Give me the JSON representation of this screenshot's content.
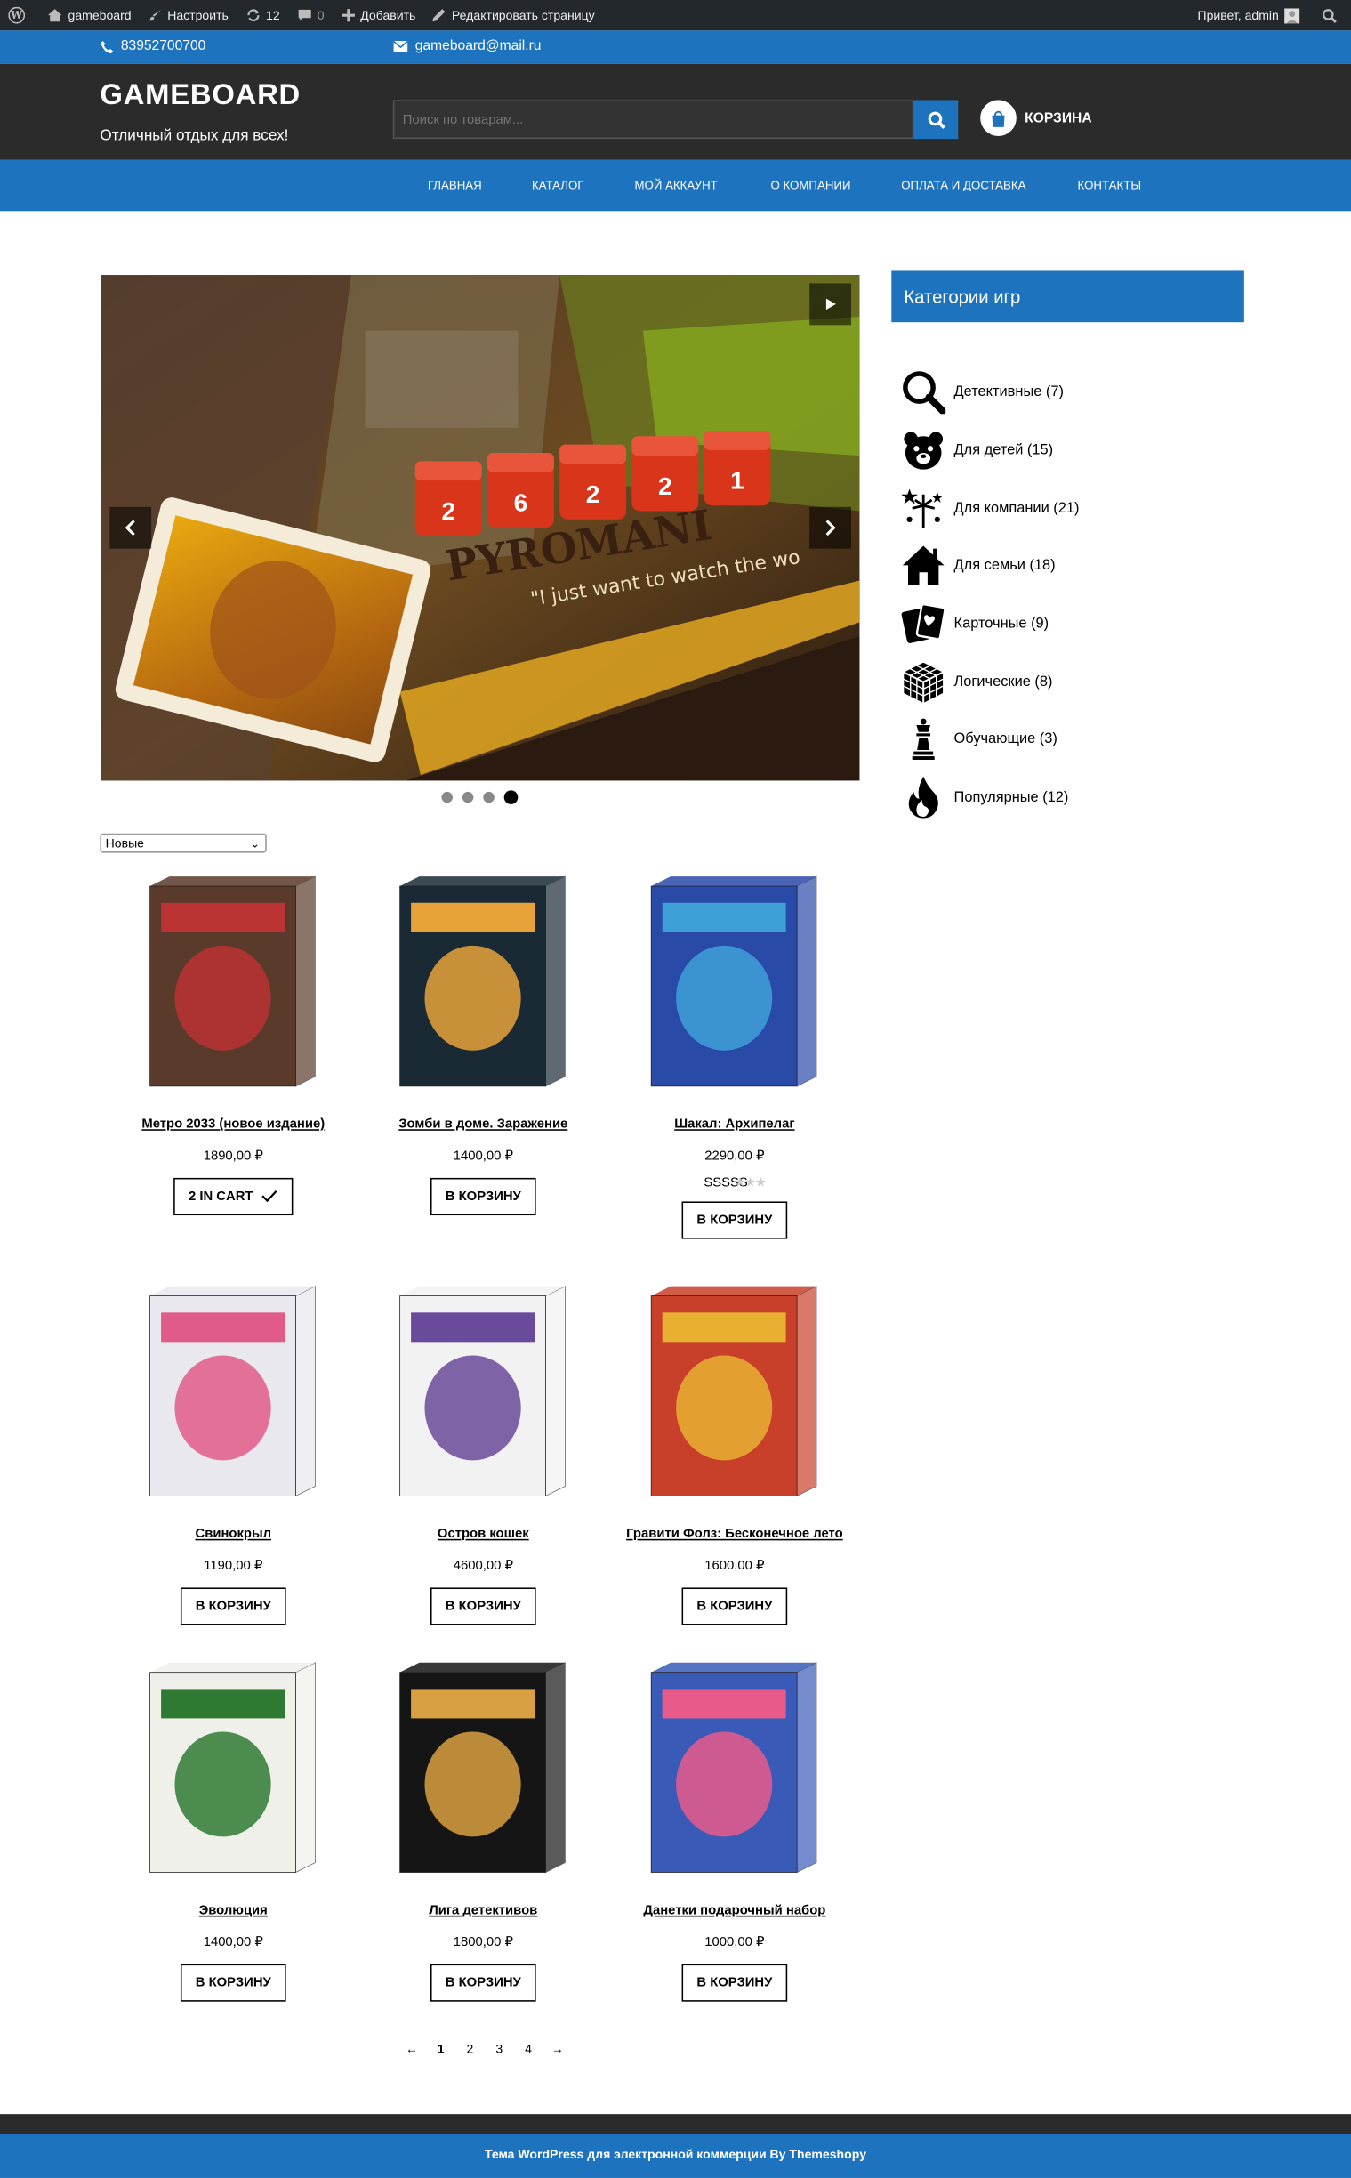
{
  "admin_bar": {
    "site": "gameboard",
    "customize": "Настроить",
    "updates": "12",
    "comments": "0",
    "add_new": "Добавить",
    "edit_page": "Редактировать страницу",
    "greeting": "Привет, admin"
  },
  "contacts": {
    "phone": "83952700700",
    "email": "gameboard@mail.ru"
  },
  "header": {
    "logo": "GAMEBOARD",
    "tagline": "Отличный отдых для всех!",
    "search_placeholder": "Поиск по товарам...",
    "cart_label": "КОРЗИНА"
  },
  "nav": {
    "items": [
      "ГЛАВНАЯ",
      "КАТАЛОГ",
      "МОЙ АККАУНТ",
      "О КОМПАНИИ",
      "ОПЛАТА И ДОСТАВКА",
      "КОНТАКТЫ"
    ]
  },
  "slider": {
    "brand_text": "PYROMANI",
    "quote_text": "\"I just want to watch the wo",
    "dice": [
      "2",
      "6",
      "2",
      "2",
      "1"
    ],
    "dots": 4,
    "active_dot": 4
  },
  "sort": {
    "selected": "Новые"
  },
  "products": [
    {
      "title": "Метро 2033 (новое издание)",
      "price": "1890,00 ₽",
      "button": "2 IN CART",
      "in_cart": true,
      "rating": null,
      "box_color": "#5a3a2a",
      "accent": "#b33"
    },
    {
      "title": "Зомби в доме. Заражение",
      "price": "1400,00 ₽",
      "button": "В КОРЗИНУ",
      "in_cart": false,
      "rating": null,
      "box_color": "#1a2a35",
      "accent": "#e8a23a"
    },
    {
      "title": "Шакал: Архипелаг",
      "price": "2290,00 ₽",
      "button": "В КОРЗИНУ",
      "in_cart": false,
      "rating": "SSSSS",
      "box_color": "#2a4aa8",
      "accent": "#3fa0d8"
    },
    {
      "title": "Свинокрыл",
      "price": "1190,00 ₽",
      "button": "В КОРЗИНУ",
      "in_cart": false,
      "rating": null,
      "box_color": "#e8e8ee",
      "accent": "#e05a8a"
    },
    {
      "title": "Остров кошек",
      "price": "4600,00 ₽",
      "button": "В КОРЗИНУ",
      "in_cart": false,
      "rating": null,
      "box_color": "#f2f2f2",
      "accent": "#6a4a9a"
    },
    {
      "title": "Гравити Фолз: Бесконечное лето",
      "price": "1600,00 ₽",
      "button": "В КОРЗИНУ",
      "in_cart": false,
      "rating": null,
      "box_color": "#c8402a",
      "accent": "#e8b030"
    },
    {
      "title": "Эволюция",
      "price": "1400,00 ₽",
      "button": "В КОРЗИНУ",
      "in_cart": false,
      "rating": null,
      "box_color": "#f0f0ea",
      "accent": "#2f7a32"
    },
    {
      "title": "Лига детективов",
      "price": "1800,00 ₽",
      "button": "В КОРЗИНУ",
      "in_cart": false,
      "rating": null,
      "box_color": "#151515",
      "accent": "#d8a040"
    },
    {
      "title": "Данетки подарочный набор",
      "price": "1000,00 ₽",
      "button": "В КОРЗИНУ",
      "in_cart": false,
      "rating": null,
      "box_color": "#3a5ab8",
      "accent": "#e85a8a"
    }
  ],
  "pagination": {
    "prev": "←",
    "pages": [
      "1",
      "2",
      "3",
      "4"
    ],
    "current": "1",
    "next": "→"
  },
  "sidebar": {
    "title": "Категории игр",
    "categories": [
      {
        "label": "Детективные (7)",
        "icon": "magnifier-icon"
      },
      {
        "label": "Для детей (15)",
        "icon": "bear-icon"
      },
      {
        "label": "Для компании (21)",
        "icon": "fireworks-icon"
      },
      {
        "label": "Для семьи (18)",
        "icon": "house-icon"
      },
      {
        "label": "Карточные (9)",
        "icon": "cards-icon"
      },
      {
        "label": "Логические (8)",
        "icon": "cube-icon"
      },
      {
        "label": "Обучающие (3)",
        "icon": "chess-queen-icon"
      },
      {
        "label": "Популярные (12)",
        "icon": "flame-icon"
      }
    ]
  },
  "footer": {
    "text": "Тема WordPress для электронной коммерции By Themeshopy"
  },
  "colors": {
    "brand_blue": "#1e73be",
    "header_dark": "#2b2b2b",
    "admin_bar": "#23282d"
  }
}
